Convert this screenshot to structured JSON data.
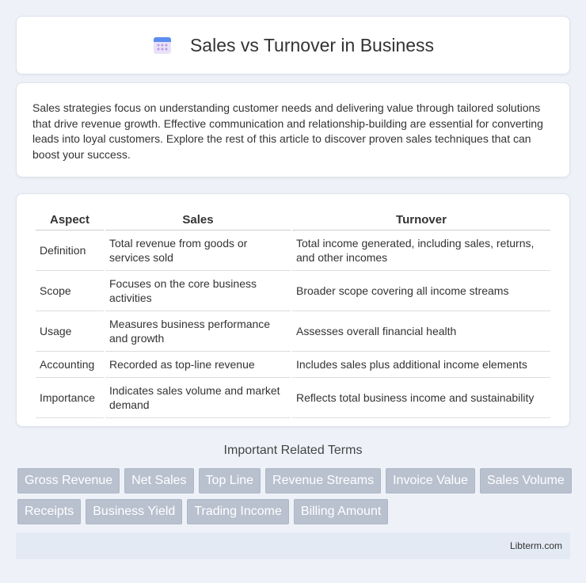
{
  "header": {
    "title": "Sales vs Turnover in Business",
    "icon": "calendar-icon"
  },
  "intro": {
    "text": "Sales strategies focus on understanding customer needs and delivering value through tailored solutions that drive revenue growth. Effective communication and relationship-building are essential for converting leads into loyal customers. Explore the rest of this article to discover proven sales techniques that can boost your success."
  },
  "table": {
    "headers": [
      "Aspect",
      "Sales",
      "Turnover"
    ],
    "rows": [
      [
        "Definition",
        "Total revenue from goods or services sold",
        "Total income generated, including sales, returns, and other incomes"
      ],
      [
        "Scope",
        "Focuses on the core business activities",
        "Broader scope covering all income streams"
      ],
      [
        "Usage",
        "Measures business performance and growth",
        "Assesses overall financial health"
      ],
      [
        "Accounting",
        "Recorded as top-line revenue",
        "Includes sales plus additional income elements"
      ],
      [
        "Importance",
        "Indicates sales volume and market demand",
        "Reflects total business income and sustainability"
      ]
    ]
  },
  "related": {
    "title": "Important Related Terms",
    "tags": [
      "Gross Revenue",
      "Net Sales",
      "Top Line",
      "Revenue Streams",
      "Invoice Value",
      "Sales Volume",
      "Receipts",
      "Business Yield",
      "Trading Income",
      "Billing Amount"
    ]
  },
  "footer": {
    "text": "Libterm.com"
  }
}
